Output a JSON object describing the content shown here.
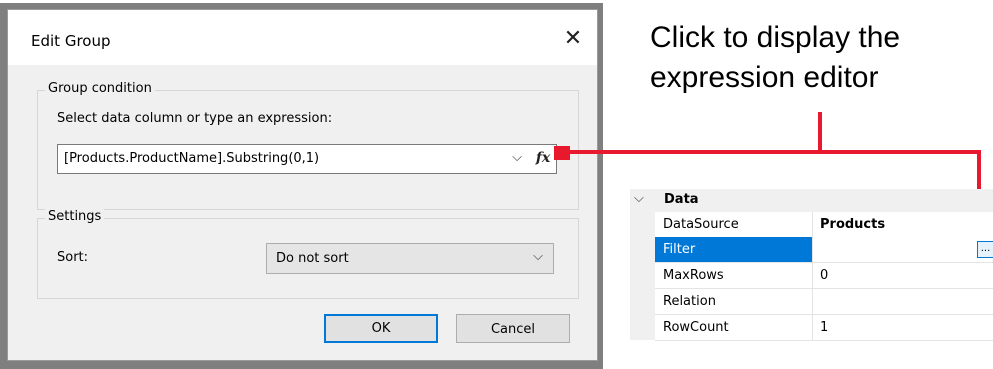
{
  "dialog": {
    "title": "Edit Group",
    "close_icon": "close-icon",
    "group_condition": {
      "legend": "Group condition",
      "prompt": "Select data column or type an expression:",
      "expression_value": "[Products.ProductName].Substring(0,1)",
      "dropdown_icon": "chevron-down-icon",
      "fx_label": "fx"
    },
    "settings": {
      "legend": "Settings",
      "sort_label": "Sort:",
      "sort_value": "Do not sort",
      "dropdown_icon": "chevron-down-icon"
    },
    "buttons": {
      "ok": "OK",
      "cancel": "Cancel"
    }
  },
  "callout": {
    "line1": "Click to display the",
    "line2": "expression editor",
    "color": "#e8192c"
  },
  "property_grid": {
    "category": "Data",
    "category_icon": "chevron-down-icon",
    "rows": [
      {
        "name": "DataSource",
        "value": "Products",
        "bold": true
      },
      {
        "name": "Filter",
        "value": "",
        "selected": true,
        "button": "..."
      },
      {
        "name": "MaxRows",
        "value": "0"
      },
      {
        "name": "Relation",
        "value": ""
      },
      {
        "name": "RowCount",
        "value": "1"
      }
    ]
  },
  "colors": {
    "accent": "#0078d7",
    "callout_red": "#e8192c",
    "dialog_bg": "#f0f0f0"
  }
}
